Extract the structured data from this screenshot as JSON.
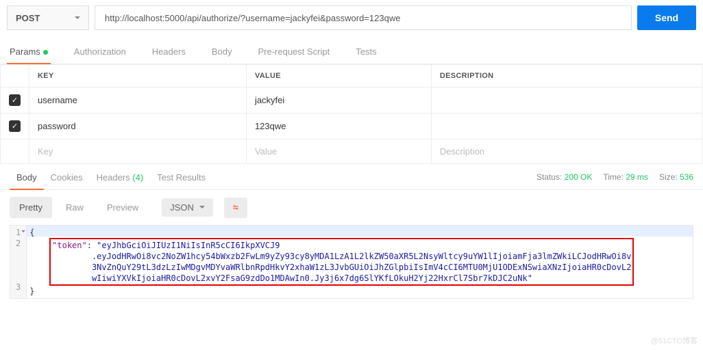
{
  "request": {
    "method": "POST",
    "url": "http://localhost:5000/api/authorize/?username=jackyfei&password=123qwe",
    "send_label": "Send"
  },
  "req_tabs": [
    {
      "label": "Params",
      "active": true,
      "indicator": true
    },
    {
      "label": "Authorization"
    },
    {
      "label": "Headers"
    },
    {
      "label": "Body"
    },
    {
      "label": "Pre-request Script"
    },
    {
      "label": "Tests"
    }
  ],
  "param_headers": {
    "key": "KEY",
    "value": "VALUE",
    "desc": "DESCRIPTION"
  },
  "params": [
    {
      "enabled": true,
      "key": "username",
      "value": "jackyfei",
      "desc": ""
    },
    {
      "enabled": true,
      "key": "password",
      "value": "123qwe",
      "desc": ""
    }
  ],
  "param_placeholder": {
    "key": "Key",
    "value": "Value",
    "desc": "Description"
  },
  "resp_tabs": [
    {
      "label": "Body",
      "active": true
    },
    {
      "label": "Cookies"
    },
    {
      "label": "Headers",
      "count": "(4)"
    },
    {
      "label": "Test Results"
    }
  ],
  "resp_meta": {
    "status_label": "Status:",
    "status_value": "200 OK",
    "time_label": "Time:",
    "time_value": "29 ms",
    "size_label": "Size:",
    "size_value": "536"
  },
  "format_tabs": [
    {
      "label": "Pretty",
      "active": true
    },
    {
      "label": "Raw"
    },
    {
      "label": "Preview"
    }
  ],
  "format_type": "JSON",
  "wrap_icon": "⇋",
  "response_body": {
    "line1": "{",
    "token_key": "\"token\"",
    "sep": ": ",
    "token_l1": "\"eyJhbGciOiJIUzI1NiIsInR5cCI6IkpXVCJ9",
    "token_l2": ".eyJodHRwOi8vc2NoZW1hcy54bWxzb2FwLm9yZy93cy8yMDA1LzA1L2lkZW50aXR5L2NsyWltcy9uYW1lIjoiamFja3lmZWkiLCJodHRwOi8v",
    "token_l3": "3NvZnQuY29tL3dzLzIwMDgvMDYvaWRlbnRpdHkvY2xhaW1zL3JvbGUiOiJhZGlpbiIsImV4cCI6MTU0MjU1ODExNSwiaXNzIjoiaHR0cDovL2",
    "token_l4": "wIiwiYXVkIjoiaHR0cDovL2xvY2FsaG9zdDo1MDAwIn0.Jy3j6x7dg6SlYKfLOkuH2Yj22HxrCl7Sbr7kDJC2uNk\"",
    "line3": "}"
  },
  "watermark": "@51CTO博客"
}
